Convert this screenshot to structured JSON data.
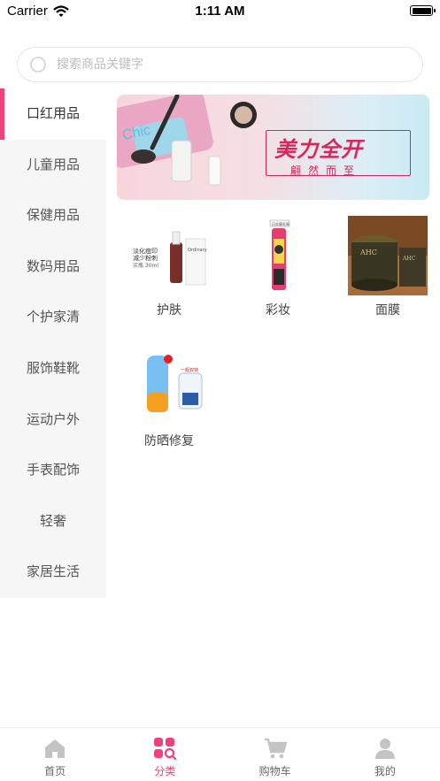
{
  "status_bar": {
    "carrier": "Carrier",
    "time": "1:11 AM"
  },
  "search": {
    "placeholder": "搜索商品关键字"
  },
  "sidebar": {
    "items": [
      {
        "label": "口红用品",
        "active": true
      },
      {
        "label": "儿童用品"
      },
      {
        "label": "保健用品"
      },
      {
        "label": "数码用品"
      },
      {
        "label": "个护家清"
      },
      {
        "label": "服饰鞋靴"
      },
      {
        "label": "运动户外"
      },
      {
        "label": "手表配饰"
      },
      {
        "label": "轻奢"
      },
      {
        "label": "家居生活"
      }
    ]
  },
  "banner": {
    "title": "美力全开",
    "subtitle": "翩然而至",
    "tag": "Chic",
    "accent": "#d8265a"
  },
  "categories": [
    {
      "label": "护肤",
      "img_text": "淡化痘印\n减少粉刺\n买瓶 30ml"
    },
    {
      "label": "彩妆",
      "img_text": "日本睫毛膏"
    },
    {
      "label": "面膜",
      "img_text": "AHC"
    },
    {
      "label": "防晒修复",
      "img_text": "一瓶双效"
    }
  ],
  "tab_bar": {
    "items": [
      {
        "label": "首页",
        "icon": "home-icon"
      },
      {
        "label": "分类",
        "icon": "category-icon",
        "active": true
      },
      {
        "label": "购物车",
        "icon": "cart-icon"
      },
      {
        "label": "我的",
        "icon": "profile-icon"
      }
    ]
  },
  "colors": {
    "accent": "#f0427a",
    "sidebar_bg": "#f6f6f6"
  }
}
